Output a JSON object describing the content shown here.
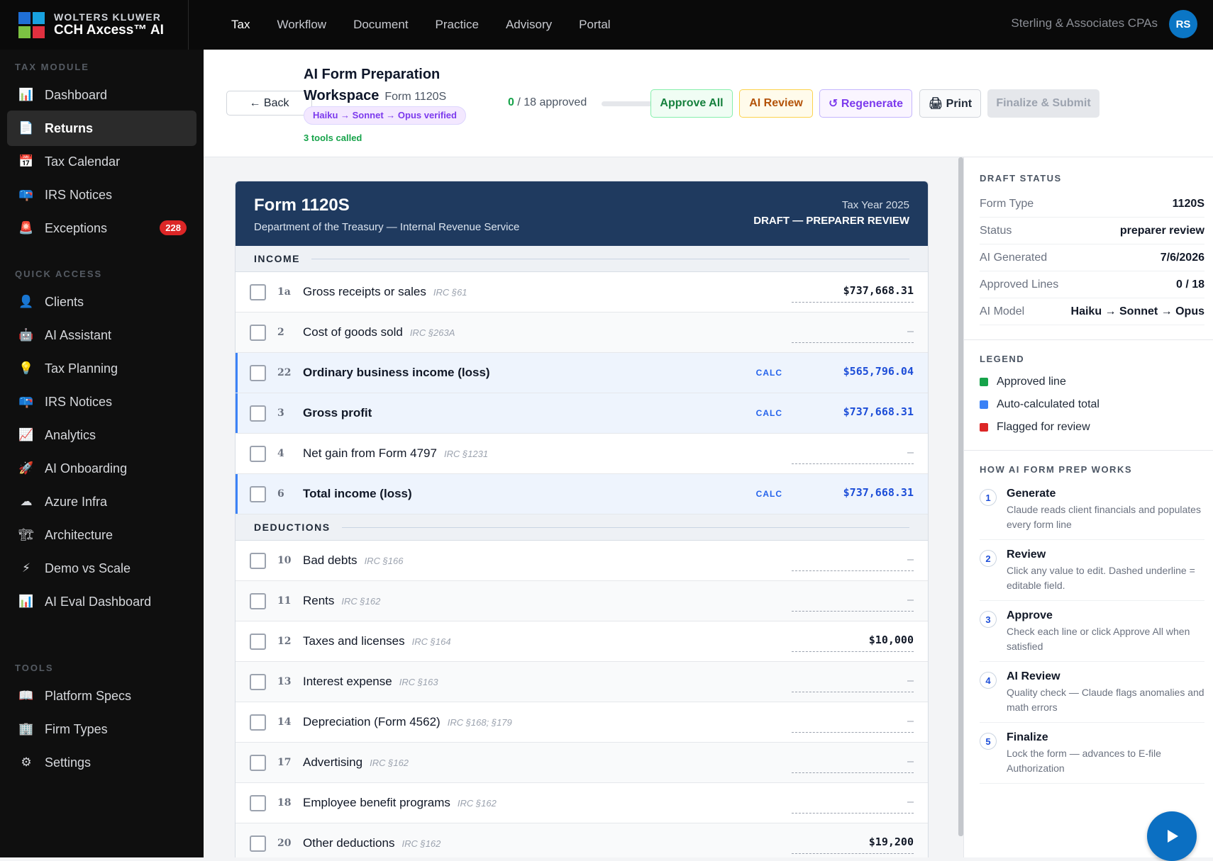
{
  "brand": {
    "line1": "WOLTERS KLUWER",
    "line2": "CCH Axcess™ AI",
    "colors": [
      "#1f6fd6",
      "#18a2e0",
      "#7cc242",
      "#e0303f"
    ]
  },
  "topnav": [
    "Tax",
    "Workflow",
    "Document",
    "Practice",
    "Advisory",
    "Portal"
  ],
  "firm": "Sterling & Associates CPAs",
  "user_initials": "RS",
  "sidebar": {
    "tax_module_label": "TAX MODULE",
    "tax_module": [
      {
        "icon": "📊",
        "label": "Dashboard"
      },
      {
        "icon": "📄",
        "label": "Returns"
      },
      {
        "icon": "📅",
        "label": "Tax Calendar"
      },
      {
        "icon": "📪",
        "label": "IRS Notices"
      },
      {
        "icon": "🚨",
        "label": "Exceptions",
        "badge": "228"
      }
    ],
    "quick_access_label": "QUICK ACCESS",
    "quick_access": [
      {
        "icon": "👤",
        "label": "Clients"
      },
      {
        "icon": "🤖",
        "label": "AI Assistant"
      },
      {
        "icon": "💡",
        "label": "Tax Planning"
      },
      {
        "icon": "📪",
        "label": "IRS Notices"
      },
      {
        "icon": "📈",
        "label": "Analytics"
      },
      {
        "icon": "🚀",
        "label": "AI Onboarding"
      },
      {
        "icon": "☁",
        "label": "Azure Infra"
      },
      {
        "icon": "🏗",
        "label": "Architecture"
      },
      {
        "icon": "⚡",
        "label": "Demo vs Scale"
      },
      {
        "icon": "📊",
        "label": "AI Eval Dashboard"
      }
    ],
    "tools_label": "TOOLS",
    "tools": [
      {
        "icon": "📖",
        "label": "Platform Specs"
      },
      {
        "icon": "🏢",
        "label": "Firm Types"
      },
      {
        "icon": "⚙",
        "label": "Settings"
      }
    ]
  },
  "header": {
    "back": "← Back",
    "title": "AI Form Preparation Workspace",
    "form_tag": "Form 1120S",
    "pill": "Haiku → Sonnet → Opus verified",
    "tools_called": "3 tools called",
    "approved_count": "0",
    "approved_total": "/ 18 approved",
    "progress_fraction": 0,
    "buttons": {
      "approve_all": "Approve All",
      "ai_review": "AI Review",
      "regenerate": "↺ Regenerate",
      "print": "🖨 Print",
      "finalize": "Finalize & Submit"
    }
  },
  "form": {
    "title": "Form 1120S",
    "subtitle": "Department of the Treasury — Internal Revenue Service",
    "tax_year": "Tax Year 2025",
    "status": "DRAFT — PREPARER REVIEW",
    "sections": [
      {
        "name": "INCOME",
        "rows": [
          {
            "num": "1a",
            "desc": "Gross receipts or sales",
            "irc": "IRC §61",
            "amount": "$737,668.31",
            "calc": false
          },
          {
            "num": "2",
            "desc": "Cost of goods sold",
            "irc": "IRC §263A",
            "amount": "–",
            "calc": false
          },
          {
            "num": "22",
            "desc": "Ordinary business income (loss)",
            "irc": "",
            "amount": "$565,796.04",
            "calc": true,
            "tag": "CALC"
          },
          {
            "num": "3",
            "desc": "Gross profit",
            "irc": "",
            "amount": "$737,668.31",
            "calc": true,
            "tag": "CALC"
          },
          {
            "num": "4",
            "desc": "Net gain from Form 4797",
            "irc": "IRC §1231",
            "amount": "–",
            "calc": false
          },
          {
            "num": "6",
            "desc": "Total income (loss)",
            "irc": "",
            "amount": "$737,668.31",
            "calc": true,
            "tag": "CALC"
          }
        ]
      },
      {
        "name": "DEDUCTIONS",
        "rows": [
          {
            "num": "10",
            "desc": "Bad debts",
            "irc": "IRC §166",
            "amount": "–",
            "calc": false
          },
          {
            "num": "11",
            "desc": "Rents",
            "irc": "IRC §162",
            "amount": "–",
            "calc": false
          },
          {
            "num": "12",
            "desc": "Taxes and licenses",
            "irc": "IRC §164",
            "amount": "$10,000",
            "calc": false
          },
          {
            "num": "13",
            "desc": "Interest expense",
            "irc": "IRC §163",
            "amount": "–",
            "calc": false
          },
          {
            "num": "14",
            "desc": "Depreciation (Form 4562)",
            "irc": "IRC §168; §179",
            "amount": "–",
            "calc": false
          },
          {
            "num": "17",
            "desc": "Advertising",
            "irc": "IRC §162",
            "amount": "–",
            "calc": false
          },
          {
            "num": "18",
            "desc": "Employee benefit programs",
            "irc": "IRC §162",
            "amount": "–",
            "calc": false
          },
          {
            "num": "20",
            "desc": "Other deductions",
            "irc": "IRC §162",
            "amount": "$19,200",
            "calc": false
          }
        ]
      }
    ]
  },
  "right_panel": {
    "draft_status_label": "DRAFT STATUS",
    "draft_status": [
      {
        "k": "Form Type",
        "v": "1120S"
      },
      {
        "k": "Status",
        "v": "preparer review"
      },
      {
        "k": "AI Generated",
        "v": "7/6/2026"
      },
      {
        "k": "Approved Lines",
        "v": "0 / 18"
      },
      {
        "k": "AI Model",
        "v": "Haiku → Sonnet → Opus"
      }
    ],
    "legend_label": "LEGEND",
    "legend": [
      {
        "color": "#16a34a",
        "label": "Approved line"
      },
      {
        "color": "#3b82f6",
        "label": "Auto-calculated total"
      },
      {
        "color": "#dc2626",
        "label": "Flagged for review"
      }
    ],
    "how_label": "HOW AI FORM PREP WORKS",
    "steps": [
      {
        "n": "1",
        "title": "Generate",
        "desc": "Claude reads client financials and populates every form line"
      },
      {
        "n": "2",
        "title": "Review",
        "desc": "Click any value to edit. Dashed underline = editable field."
      },
      {
        "n": "3",
        "title": "Approve",
        "desc": "Check each line or click Approve All when satisfied"
      },
      {
        "n": "4",
        "title": "AI Review",
        "desc": "Quality check — Claude flags anomalies and math errors"
      },
      {
        "n": "5",
        "title": "Finalize",
        "desc": "Lock the form — advances to E-file Authorization"
      }
    ]
  }
}
